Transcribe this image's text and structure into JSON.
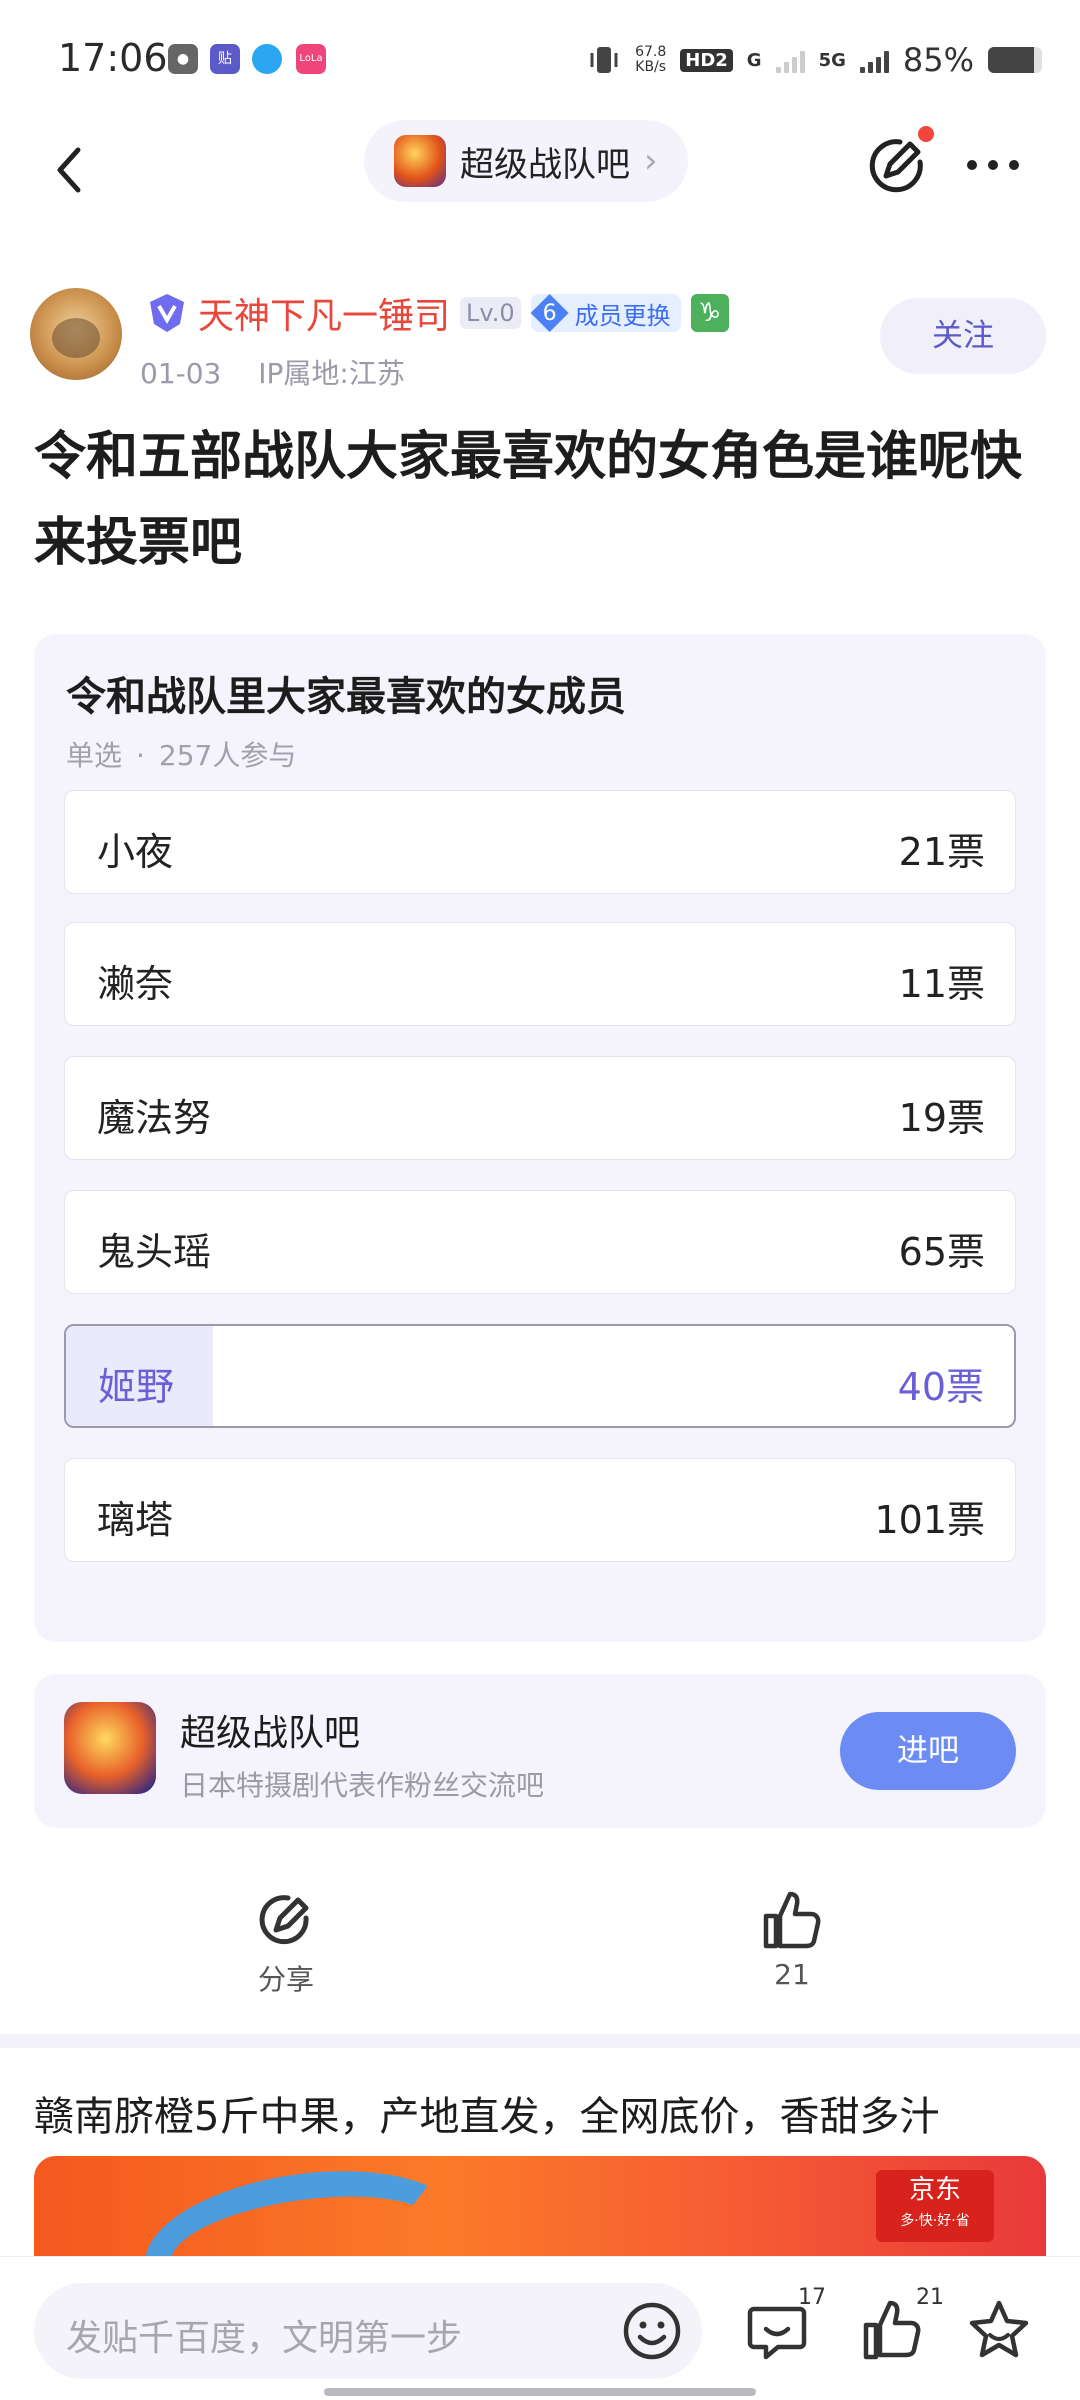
{
  "status_bar": {
    "time": "17:06",
    "apps": [
      {
        "name": "wechat-icon",
        "color": "#555555",
        "glyph": ""
      },
      {
        "name": "tieba-icon",
        "color": "#5c59c8",
        "glyph": "贴"
      },
      {
        "name": "qq-icon",
        "color": "#2aa7f0",
        "glyph": ""
      },
      {
        "name": "lofter-icon",
        "color": "#f0457a",
        "glyph": "LoLa"
      }
    ],
    "net_speed": "67.8",
    "net_unit": "KB/s",
    "hd_tag": "HD2",
    "gen_a": "G",
    "gen_b": "5G",
    "battery": "85%"
  },
  "nav": {
    "forum_name": "超级战队吧",
    "chevron": "›"
  },
  "author": {
    "name": "天神下凡一锤司",
    "level": "Lv.0",
    "member_level": "6",
    "member_label": "成员更换",
    "zodiac": "♑",
    "date": "01-03",
    "ip": "IP属地:江苏",
    "follow_label": "关注"
  },
  "post": {
    "title": "令和五部战队大家最喜欢的女角色是谁呢快来投票吧"
  },
  "poll": {
    "title": "令和战队里大家最喜欢的女成员",
    "type": "单选",
    "participants": "257人参与",
    "options": [
      {
        "label": "小夜",
        "votes": "21票"
      },
      {
        "label": "濑奈",
        "votes": "11票"
      },
      {
        "label": "魔法努",
        "votes": "19票"
      },
      {
        "label": "鬼头瑶",
        "votes": "65票"
      },
      {
        "label": "姬野",
        "votes": "40票"
      },
      {
        "label": "璃塔",
        "votes": "101票"
      }
    ],
    "selected_fill_fraction": 0.155
  },
  "forum_card": {
    "name": "超级战队吧",
    "desc": "日本特摄剧代表作粉丝交流吧",
    "enter_label": "进吧"
  },
  "actions": {
    "share_label": "分享",
    "like_count": "21"
  },
  "ad": {
    "title": "赣南脐橙5斤中果，产地直发，全网底价，香甜多汁",
    "brand": "京东",
    "slogan": "多·快·好·省"
  },
  "bottom_bar": {
    "comment_placeholder": "发贴千百度，文明第一步",
    "comment_count": "17",
    "like_count": "21"
  },
  "colors": {
    "accent": "#6a5fd6",
    "author_name": "#e8473b",
    "enter_button": "#6c8cf4"
  }
}
